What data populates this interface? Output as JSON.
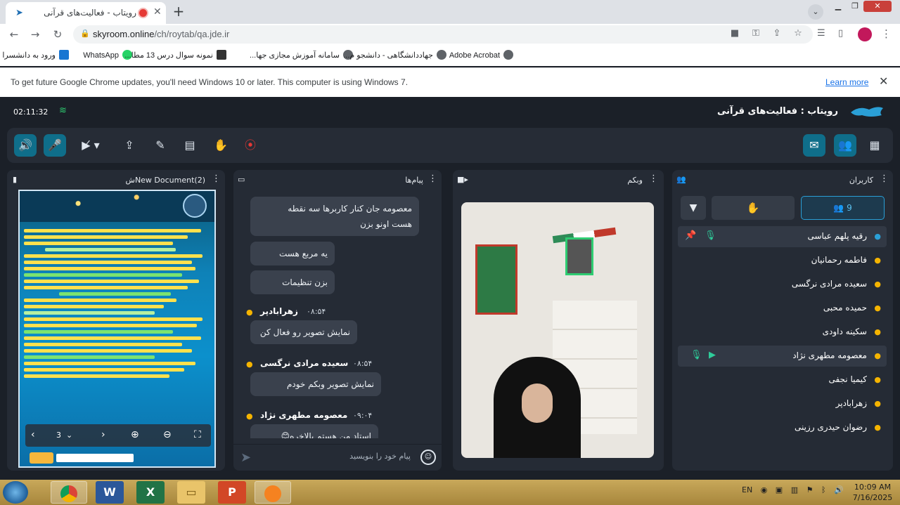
{
  "browser": {
    "tab_title": "رویتاب - فعالیت‌های قرآنی",
    "url_host": "skyroom.online",
    "url_path": "/ch/roytab/qa.jde.ir",
    "bookmarks": [
      "ورود به دانشسرا",
      "WhatsApp",
      "نمونه سوال درس 13 مطا...",
      "سامانه آموزش مجازی جها...",
      "جهاددانشگاهی - دانشجو م...",
      "Adobe Acrobat"
    ],
    "infobar_message": "To get future Google Chrome updates, you'll need Windows 10 or later. This computer is using Windows 7.",
    "infobar_link": "Learn more"
  },
  "app": {
    "title": "رویتاب : فعالیت‌های قرآنی",
    "elapsed_time": "02:11:32",
    "accent_color": "#0f6e8a"
  },
  "panels": {
    "document": {
      "title": "New Document(2)ش",
      "page": "3"
    },
    "messages": {
      "title": "پیام‌ها",
      "composer_placeholder": "پیام خود را بنویسید",
      "items": [
        {
          "text1": "معصومه جان کنار کاربرها سه نقطه",
          "text2": "هست اونو بزن"
        },
        {
          "text1": "یه مربع هست"
        },
        {
          "text1": "بزن تنظیمات"
        },
        {
          "author": "زهرابادپر",
          "time": "۰۸:۵۴",
          "text1": "نمایش تصویر رو فعال کن"
        },
        {
          "author": "سعیده مرادی نرگسی",
          "time": "۰۸:۵۴",
          "text1": "نمایش تصویر وبکم خودم"
        },
        {
          "author": "معصومه مطهری نژاد",
          "time": "۰۹:۰۴",
          "text1": "استاد من هستم بالاخره😊"
        }
      ]
    },
    "webcam": {
      "title": "وبکم"
    },
    "users": {
      "title": "کاربران",
      "count": "9",
      "list": [
        {
          "name": "رقیه پلهم عباسی"
        },
        {
          "name": "فاطمه رحمانیان"
        },
        {
          "name": "سعیده مرادی نرگسی"
        },
        {
          "name": "حمیده محبی"
        },
        {
          "name": "سکینه داودی"
        },
        {
          "name": "معصومه مطهری نژاد"
        },
        {
          "name": "کیمیا نجفی"
        },
        {
          "name": "زهرابادپر"
        },
        {
          "name": "رضوان حیدری رزینی"
        }
      ]
    }
  },
  "taskbar": {
    "language": "EN",
    "time": "10:09 AM",
    "date": "7/16/2025"
  }
}
